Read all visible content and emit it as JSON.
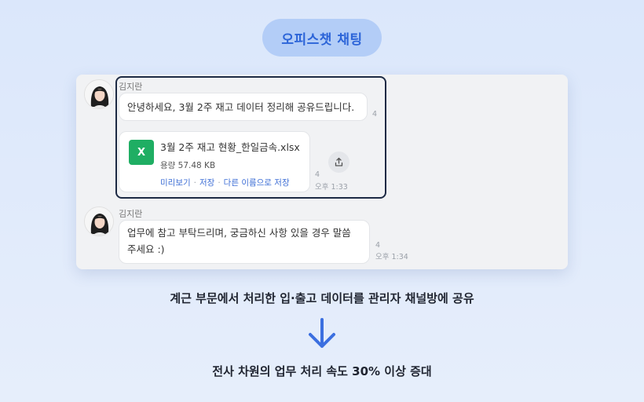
{
  "badge": {
    "label": "오피스챗 채팅"
  },
  "messages": [
    {
      "sender": "김지란",
      "text": "안녕하세요, 3월 2주 재고 데이터 정리해 공유드립니다.",
      "unread": "4"
    }
  ],
  "file": {
    "icon_letter": "X",
    "name": "3월 2주 재고 현황_한일금속.xlsx",
    "size": "용량 57.48 KB",
    "actions": {
      "preview": "미리보기",
      "save": "저장",
      "save_as": "다른 이름으로 저장",
      "separator": "·"
    },
    "unread": "4",
    "time": "오후 1:33"
  },
  "message2": {
    "sender": "김지란",
    "line1": "업무에 참고 부탁드리며, 궁금하신 사항 있을 경우 말씀",
    "line2": "주세요 :)",
    "unread": "4",
    "time": "오후 1:34"
  },
  "captions": {
    "top": "계근 부문에서 처리한 입·출고 데이터를 관리자 채널방에 공유",
    "bottom": "전사 차원의 업무 처리 속도 30% 이상 증대"
  },
  "colors": {
    "accent": "#2c64d8",
    "badge_bg": "#b3cdf7",
    "excel_green": "#1fae63",
    "link": "#3f6fd6",
    "arrow": "#3b6fe0"
  },
  "icons": {
    "share": "share-upload-icon",
    "arrow": "arrow-down-icon",
    "file": "excel-file-icon"
  }
}
